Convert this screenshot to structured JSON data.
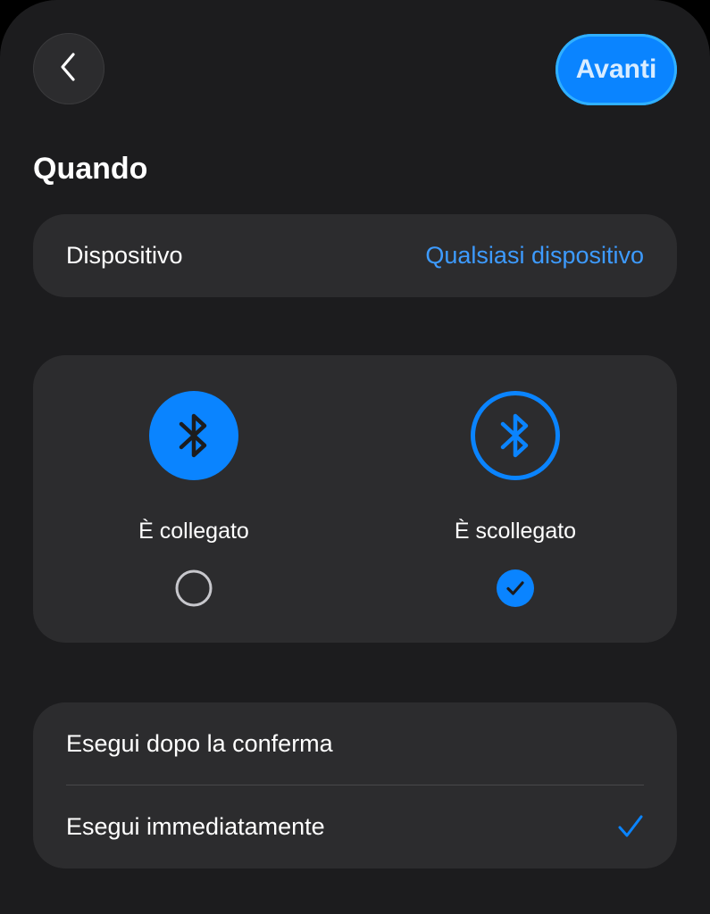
{
  "header": {
    "next_label": "Avanti",
    "back_icon": "chevron-left-icon"
  },
  "section": {
    "title": "Quando"
  },
  "device": {
    "label": "Dispositivo",
    "value": "Qualsiasi dispositivo"
  },
  "connection_state": {
    "options": [
      {
        "label": "È collegato",
        "icon": "bluetooth-icon",
        "selected": false
      },
      {
        "label": "È scollegato",
        "icon": "bluetooth-icon",
        "selected": true
      }
    ]
  },
  "run_mode": {
    "options": [
      {
        "label": "Esegui dopo la conferma",
        "selected": false
      },
      {
        "label": "Esegui immediatamente",
        "selected": true
      }
    ]
  },
  "colors": {
    "background": "#1c1c1e",
    "card": "#2c2c2e",
    "accent": "#0a84ff",
    "link": "#3d9bff"
  }
}
